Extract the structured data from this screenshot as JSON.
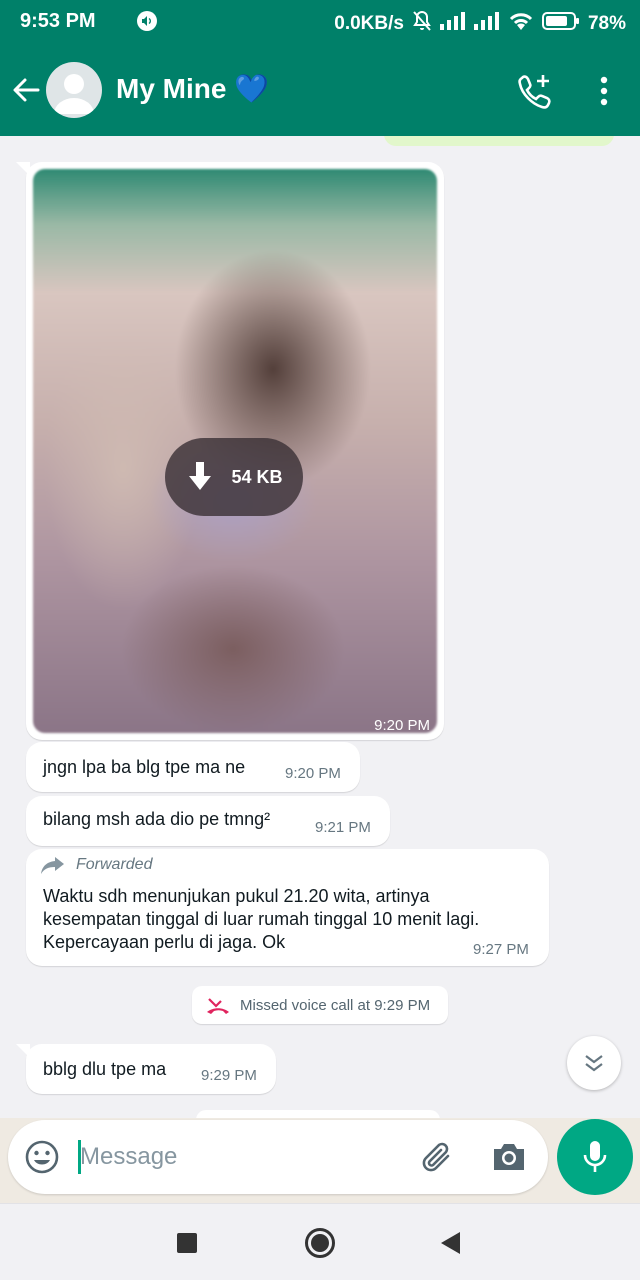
{
  "status_bar": {
    "time": "9:53 PM",
    "network_speed": "0.0KB/s",
    "battery": "78%"
  },
  "header": {
    "contact_name": "My Mine 💙"
  },
  "messages": {
    "image": {
      "size": "54 KB",
      "time": "9:20 PM"
    },
    "m1": {
      "text": "jngn lpa ba blg tpe ma ne",
      "time": "9:20 PM"
    },
    "m2": {
      "text": "bilang msh ada dio pe tmng²",
      "time": "9:21 PM"
    },
    "m3": {
      "forwarded_label": "Forwarded",
      "line1": "Waktu sdh menunjukan pukul 21.20 wita, artinya",
      "line2": "kesempatan tinggal di luar rumah tinggal 10 menit lagi.",
      "line3": "Kepercayaan perlu di jaga. Ok",
      "time": "9:27 PM"
    },
    "missed_call": "Missed voice call at 9:29 PM",
    "m4": {
      "text": "bblg dlu tpe ma",
      "time": "9:29 PM"
    }
  },
  "composer": {
    "placeholder": "Message"
  },
  "colors": {
    "primary": "#008069",
    "accent": "#00a884",
    "missed_call_icon": "#e0245e"
  }
}
